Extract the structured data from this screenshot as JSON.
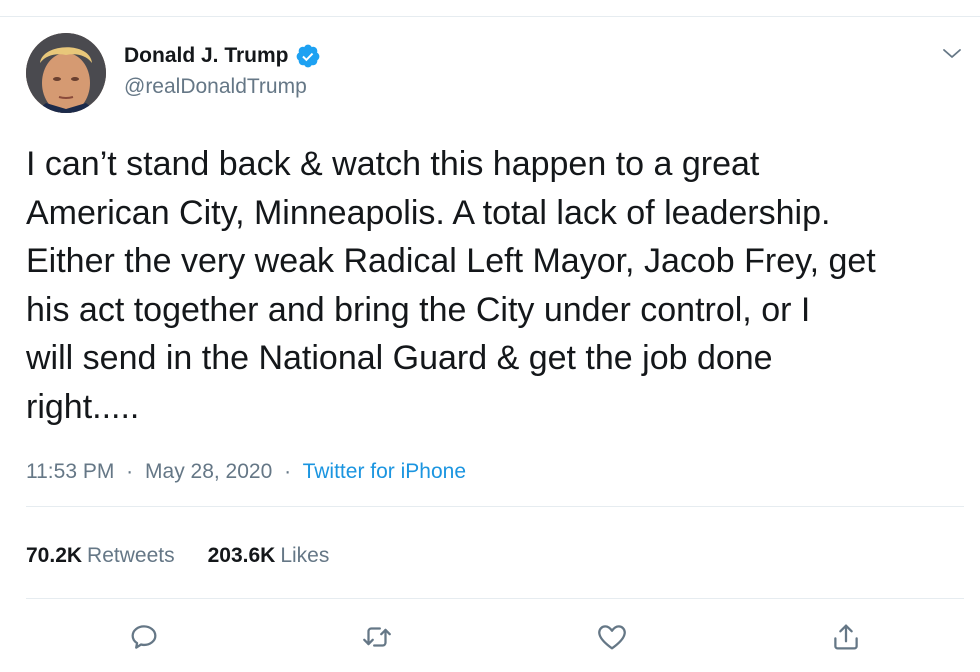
{
  "author": {
    "display_name": "Donald J. Trump",
    "handle": "@realDonaldTrump",
    "verified": true,
    "avatar_icon": "profile-photo"
  },
  "tweet": {
    "text": "I can’t stand back & watch this happen to a great\nAmerican City, Minneapolis. A total lack of leadership.\nEither the very weak Radical Left Mayor, Jacob Frey, get\nhis act together and bring the City under control, or I\nwill send in the National Guard & get the job done\nright.....",
    "time": "11:53 PM",
    "separator": "·",
    "date": "May 28, 2020",
    "source": "Twitter for iPhone"
  },
  "stats": {
    "retweets_count": "70.2K",
    "retweets_label": "Retweets",
    "likes_count": "203.6K",
    "likes_label": "Likes"
  },
  "actions": [
    {
      "icon": "reply-icon"
    },
    {
      "icon": "retweet-icon"
    },
    {
      "icon": "like-icon"
    },
    {
      "icon": "share-icon"
    }
  ],
  "colors": {
    "text_primary": "#14171a",
    "text_secondary": "#657786",
    "link": "#1b95e0",
    "divider": "#e6ecf0",
    "verified": "#1da1f2"
  }
}
